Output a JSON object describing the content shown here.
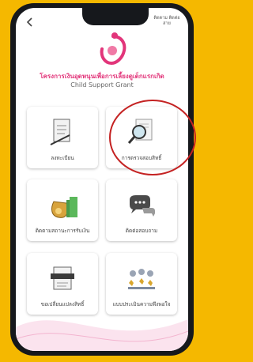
{
  "header": {
    "contact_label": "ติดตาม ติดต่อสาย"
  },
  "app": {
    "title": "โครงการเงินอุดหนุนเพื่อการเลี้ยงดูเด็กแรกเกิด",
    "subtitle": "Child Support Grant"
  },
  "menu": [
    {
      "label": "ลงทะเบียน",
      "icon": "clipboard-pen-icon"
    },
    {
      "label": "การตรวจสอบสิทธิ์",
      "icon": "magnifier-document-icon"
    },
    {
      "label": "ติดตามสถานะการรับเงิน",
      "icon": "money-bag-icon"
    },
    {
      "label": "ติดต่อสอบถาม",
      "icon": "chat-bubbles-icon"
    },
    {
      "label": "ขอเปลี่ยนแปลงสิทธิ์",
      "icon": "change-clipboard-icon"
    },
    {
      "label": "แบบประเมินความพึงพอใจ",
      "icon": "rating-stars-icon"
    }
  ],
  "colors": {
    "background": "#f5b800",
    "brand_pink": "#e2357a",
    "highlight_ring": "#c42222"
  }
}
